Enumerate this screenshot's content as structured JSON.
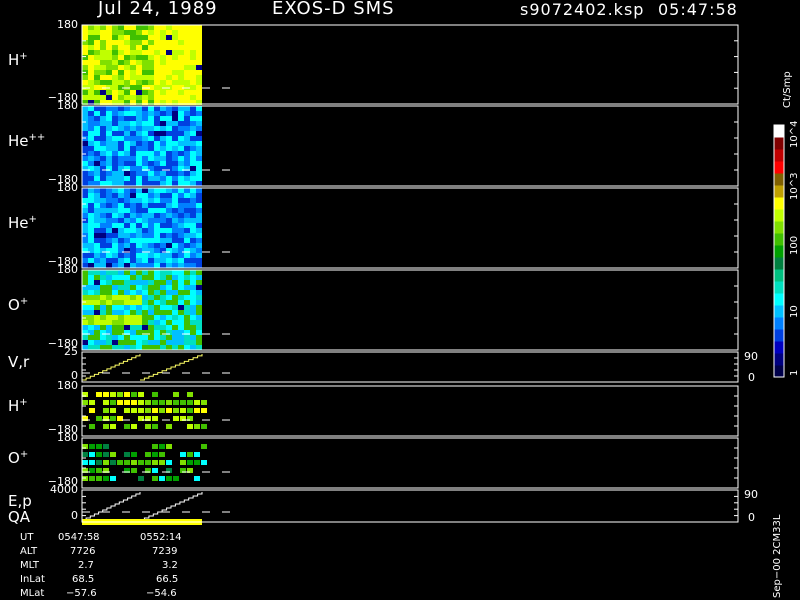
{
  "header": {
    "date": "Jul 24, 1989",
    "instrument": "EXOS-D SMS",
    "file": "s9072402.ksp",
    "time": "05:47:58"
  },
  "colors": {
    "frame": "#ffffff",
    "background": "#000000",
    "accent_line": "#ffff66"
  },
  "colorbar": {
    "unit": "Ct/Smp",
    "labels": [
      "1",
      "10",
      "100",
      "10^3",
      "10^4"
    ],
    "palette": [
      "#00004a",
      "#000080",
      "#0000c0",
      "#0040e0",
      "#0080ff",
      "#00c0ff",
      "#00ffff",
      "#00e0c0",
      "#00c080",
      "#008040",
      "#00a000",
      "#40c000",
      "#80e000",
      "#c0ff00",
      "#ffff00",
      "#c0a000",
      "#806000",
      "#ff0000",
      "#c00000",
      "#800000",
      "#ffffff"
    ]
  },
  "panels": [
    {
      "label": "H",
      "sup": "+",
      "ytop": "180",
      "ybot": "−180"
    },
    {
      "label": "He",
      "sup": "++",
      "ytop": "180",
      "ybot": "−180"
    },
    {
      "label": "He",
      "sup": "+",
      "ytop": "180",
      "ybot": "−180"
    },
    {
      "label": "O",
      "sup": "+",
      "ytop": "180",
      "ybot": "−180"
    },
    {
      "label": "V,r",
      "sup": "",
      "ytop": "25",
      "ybot": "0",
      "rtop": "90",
      "rbot": "0"
    },
    {
      "label": "H",
      "sup": "+",
      "ytop": "180",
      "ybot": "−180"
    },
    {
      "label": "O",
      "sup": "+",
      "ytop": "180",
      "ybot": "−180"
    },
    {
      "label": "E,p",
      "sup": "",
      "ytop": "4000",
      "ybot": "0",
      "rtop": "90",
      "rbot": "0",
      "sublabel": "QA"
    }
  ],
  "annotation": {
    "rows": [
      {
        "name": "UT",
        "v1": "0547:58",
        "v2": "0552:14"
      },
      {
        "name": "ALT",
        "v1": "7726",
        "v2": "7239"
      },
      {
        "name": "MLT",
        "v1": "2.7",
        "v2": "3.2"
      },
      {
        "name": "InLat",
        "v1": "68.5",
        "v2": "66.5"
      },
      {
        "name": "MLat",
        "v1": "−57.6",
        "v2": "−54.6"
      }
    ]
  },
  "footer": "Sep−00 2CM33L",
  "chart_data": {
    "type": "heatmap",
    "title": "Jul 24, 1989 EXOS-D SMS s9072402.ksp 05:47:58",
    "x": {
      "start_ut": "0547:58",
      "end_ut": "0552:14",
      "data_fraction_of_axis": 0.18
    },
    "colorbar_range": [
      1,
      10000
    ],
    "colorbar_scale": "log",
    "panels": [
      {
        "name": "H+",
        "y_range": [
          -180,
          180
        ],
        "dominant_counts": "~100-300, yellow band after ~60% of interval"
      },
      {
        "name": "He++",
        "y_range": [
          -180,
          180
        ],
        "dominant_counts": "~3-10"
      },
      {
        "name": "He+",
        "y_range": [
          -180,
          180
        ],
        "dominant_counts": "~3-10"
      },
      {
        "name": "O+",
        "y_range": [
          -180,
          180
        ],
        "dominant_counts": "~10-100 banded at low pitch angles early"
      },
      {
        "name": "V,r",
        "y_range": [
          0,
          25
        ],
        "right_range": [
          0,
          90
        ]
      },
      {
        "name": "H+",
        "y_range": [
          -180,
          180
        ],
        "dominant_counts": "~30-200 in discrete steps"
      },
      {
        "name": "O+",
        "y_range": [
          -180,
          180
        ],
        "dominant_counts": "~10-100 in discrete steps"
      },
      {
        "name": "E,p",
        "y_range": [
          0,
          4000
        ],
        "right_range": [
          0,
          90
        ]
      }
    ]
  }
}
